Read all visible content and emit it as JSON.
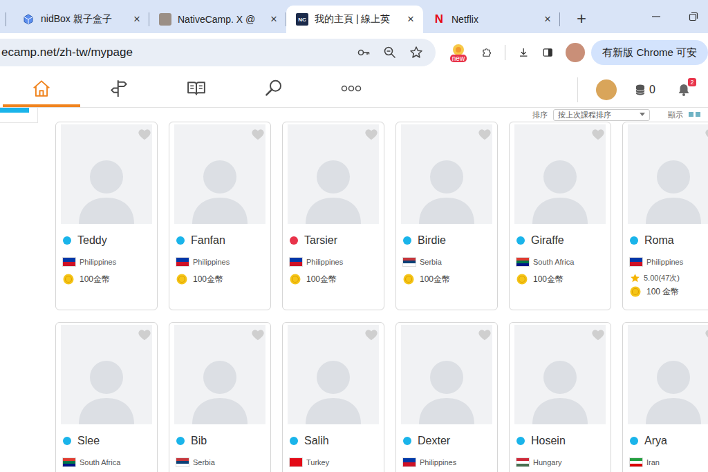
{
  "browser": {
    "tabs": [
      {
        "label": "nidBox 親子盒子",
        "kind": "cube",
        "favicon": "",
        "color": "#5b8def",
        "selected": false
      },
      {
        "label": "NativeCamp. X @",
        "kind": "photo",
        "favicon": "",
        "color": "#9b8f86",
        "selected": false
      },
      {
        "label": "我的主頁 | 線上英",
        "kind": "badge",
        "favicon": "NC",
        "color": "#1b2a4a",
        "selected": true
      },
      {
        "label": "Netflix",
        "kind": "letter",
        "favicon": "N",
        "color": "#e50914",
        "selected": false
      }
    ],
    "tab_close": "×",
    "new_tab": "+",
    "address": "ecamp.net/zh-tw/mypage",
    "extension_badge": "new",
    "update_button": "有新版 Chrome 可安"
  },
  "nav": {
    "items": [
      {
        "kind": "home",
        "selected": true
      },
      {
        "kind": "guide",
        "selected": false
      },
      {
        "kind": "book",
        "selected": false
      },
      {
        "kind": "search",
        "selected": false
      },
      {
        "kind": "more",
        "selected": false
      }
    ],
    "coins": "0",
    "notifications": "2"
  },
  "sort": {
    "label": "排序",
    "value": "按上次課程排序"
  },
  "view": {
    "label": "顯示"
  },
  "tutors": [
    {
      "name": "Teddy",
      "color": "#1ab4ea",
      "country": "Philippines",
      "flag_colors": [
        "#0038a8",
        "#ce1126"
      ],
      "coins": "100金幣",
      "favorite": false
    },
    {
      "name": "Fanfan",
      "color": "#1ab4ea",
      "country": "Philippines",
      "flag_colors": [
        "#0038a8",
        "#ce1126"
      ],
      "coins": "100金幣",
      "favorite": false
    },
    {
      "name": "Tarsier",
      "color": "#e8334a",
      "country": "Philippines",
      "flag_colors": [
        "#0038a8",
        "#ce1126"
      ],
      "coins": "100金幣",
      "favorite": false
    },
    {
      "name": "Birdie",
      "color": "#1ab4ea",
      "country": "Serbia",
      "flag_colors": [
        "#c6363c",
        "#0c4076",
        "#ffffff"
      ],
      "coins": "100金幣",
      "favorite": false
    },
    {
      "name": "Giraffe",
      "color": "#1ab4ea",
      "country": "South Africa",
      "flag_colors": [
        "#e03c31",
        "#007749",
        "#001489"
      ],
      "coins": "100金幣",
      "favorite": false
    },
    {
      "name": "Roma",
      "color": "#1ab4ea",
      "country": "Philippines",
      "flag_colors": [
        "#0038a8",
        "#ce1126"
      ],
      "rating": "5.00(47次)",
      "stars": 1,
      "coins": "100 金幣",
      "favorite": false
    },
    {
      "name": "Slee",
      "color": "#1ab4ea",
      "country": "South Africa",
      "flag_colors": [
        "#e03c31",
        "#007749",
        "#001489"
      ],
      "favorite": false
    },
    {
      "name": "Bib",
      "color": "#1ab4ea",
      "country": "Serbia",
      "flag_colors": [
        "#c6363c",
        "#0c4076",
        "#ffffff"
      ],
      "favorite": false
    },
    {
      "name": "Salih",
      "color": "#1ab4ea",
      "country": "Turkey",
      "flag_colors": [
        "#e30a17"
      ],
      "favorite": false
    },
    {
      "name": "Dexter",
      "color": "#1ab4ea",
      "country": "Philippines",
      "flag_colors": [
        "#0038a8",
        "#ce1126"
      ],
      "favorite": false
    },
    {
      "name": "Hosein",
      "color": "#1ab4ea",
      "country": "Hungary",
      "flag_colors": [
        "#ce2939",
        "#ffffff",
        "#477050"
      ],
      "favorite": false
    },
    {
      "name": "Arya",
      "color": "#1ab4ea",
      "country": "Iran",
      "flag_colors": [
        "#239f40",
        "#ffffff",
        "#da0000"
      ],
      "favorite": false
    }
  ]
}
